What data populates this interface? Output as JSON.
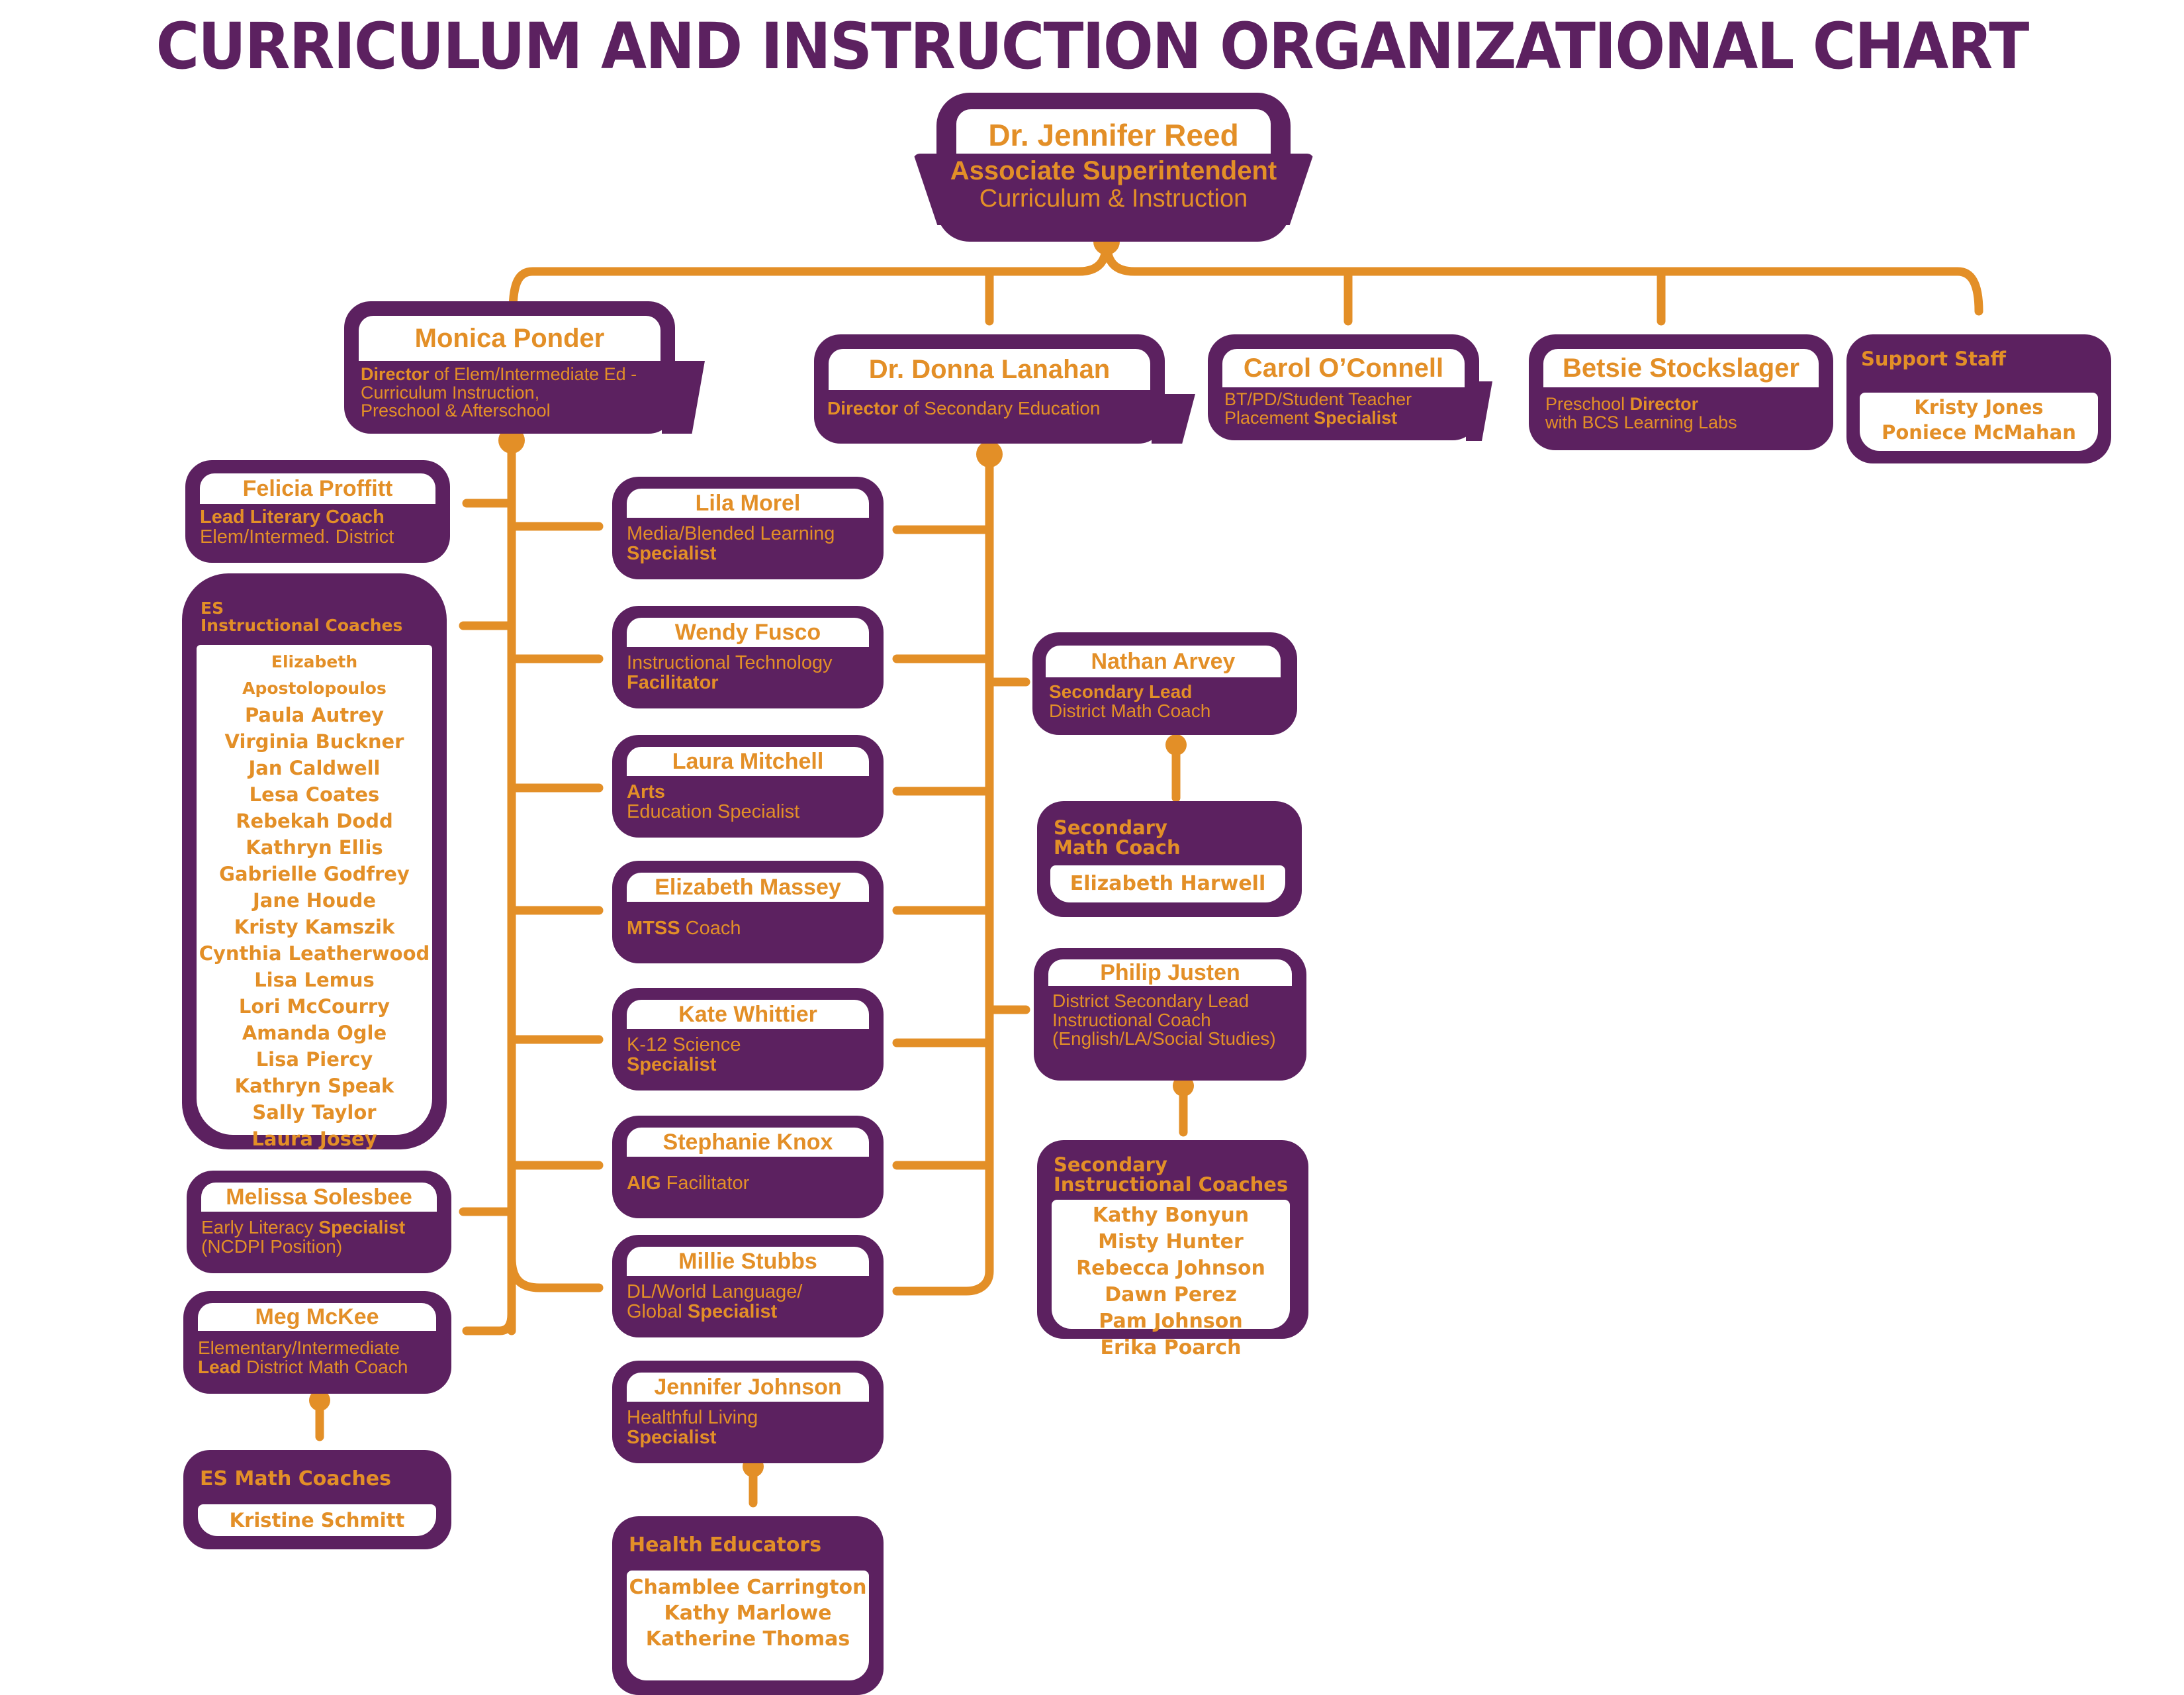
{
  "title": "CURRICULUM AND INSTRUCTION ORGANIZATIONAL CHART",
  "colors": {
    "primary": "#5C2160",
    "accent": "#E38F27",
    "background": "#FFFFFF"
  },
  "top": {
    "name": "Dr. Jennifer Reed",
    "title_bold": "Associate Superintendent",
    "title_regular": "Curriculum & Instruction"
  },
  "directors": {
    "ponder": {
      "name": "Monica Ponder",
      "bold": "Director",
      "rest": " of Elem/Intermediate Ed -",
      "line2": "Curriculum Instruction,",
      "line3": "Preschool & Afterschool"
    },
    "lanahan": {
      "name": "Dr. Donna Lanahan",
      "bold": "Director",
      "rest": " of Secondary Education"
    },
    "oconnell": {
      "name": "Carol O’Connell",
      "line1": "BT/PD/Student Teacher",
      "line2_regular": "Placement ",
      "line2_bold": "Specialist"
    },
    "stockslager": {
      "name": "Betsie Stockslager",
      "line1_regular": "Preschool ",
      "line1_bold": "Director",
      "line2": "with BCS Learning Labs"
    },
    "support": {
      "heading": "Support Staff",
      "members": [
        "Kristy Jones",
        "Poniece McMahan"
      ]
    }
  },
  "ponder_reports_left": {
    "proffitt": {
      "name": "Felicia Proffitt",
      "line1_bold": "Lead Literary Coach",
      "line2": "Elem/Intermed. District"
    },
    "es_coaches": {
      "heading_line1": "ES",
      "heading_line2": "Instructional Coaches",
      "members": [
        "Elizabeth Apostolopoulos",
        "Paula Autrey",
        "Virginia Buckner",
        "Jan Caldwell",
        "Lesa Coates",
        "Rebekah Dodd",
        "Kathryn Ellis",
        "Gabrielle Godfrey",
        "Jane Houde",
        "Kristy Kamszik",
        "Cynthia Leatherwood",
        "Lisa Lemus",
        "Lori McCourry",
        "Amanda Ogle",
        "Lisa Piercy",
        "Kathryn Speak",
        "Sally Taylor",
        "Laura Josey"
      ]
    },
    "solesbee": {
      "name": "Melissa Solesbee",
      "line1_regular": "Early Literacy ",
      "line1_bold": "Specialist",
      "line2": "(NCDPI Position)"
    },
    "mckee": {
      "name": "Meg McKee",
      "line1": "Elementary/Intermediate",
      "line2_bold": "Lead",
      "line2_regular": " District Math Coach"
    },
    "es_math": {
      "heading": "ES Math Coaches",
      "members": [
        "Kristine Schmitt"
      ]
    }
  },
  "shared_reports": {
    "morel": {
      "name": "Lila Morel",
      "line1": "Media/Blended Learning",
      "line2_bold": "Specialist"
    },
    "fusco": {
      "name": "Wendy Fusco",
      "line1": "Instructional Technology",
      "line2_bold": "Facilitator"
    },
    "mitchell": {
      "name": "Laura Mitchell",
      "line1_bold": "Arts",
      "line2": "Education Specialist"
    },
    "massey": {
      "name": "Elizabeth Massey",
      "line1_bold": "MTSS",
      "line1_regular": " Coach"
    },
    "whittier": {
      "name": "Kate Whittier",
      "line1": "K-12 Science",
      "line2_bold": "Specialist"
    },
    "knox": {
      "name": "Stephanie Knox",
      "line1_bold": "AIG",
      "line1_regular": " Facilitator"
    },
    "stubbs": {
      "name": "Millie Stubbs",
      "line1": "DL/World Language/",
      "line2_regular": "Global ",
      "line2_bold": "Specialist"
    },
    "johnson": {
      "name": "Jennifer Johnson",
      "line1": "Healthful Living",
      "line2_bold": "Specialist"
    },
    "health": {
      "heading": "Health Educators",
      "members": [
        "Chamblee Carrington",
        "Kathy Marlowe",
        "Katherine Thomas"
      ]
    }
  },
  "lanahan_reports": {
    "arvey": {
      "name": "Nathan Arvey",
      "line1_bold": "Secondary Lead",
      "line2": "District Math Coach"
    },
    "sec_math": {
      "heading_line1": "Secondary",
      "heading_line2": "Math Coach",
      "members": [
        "Elizabeth Harwell"
      ]
    },
    "justen": {
      "name": "Philip Justen",
      "line1": "District Secondary Lead",
      "line2": "Instructional Coach",
      "line3": "(English/LA/Social Studies)"
    },
    "sec_coaches": {
      "heading_line1": "Secondary",
      "heading_line2": "Instructional Coaches",
      "members": [
        "Kathy Bonyun",
        "Misty Hunter",
        "Rebecca Johnson",
        "Dawn Perez",
        "Pam Johnson",
        "Erika Poarch"
      ]
    }
  }
}
